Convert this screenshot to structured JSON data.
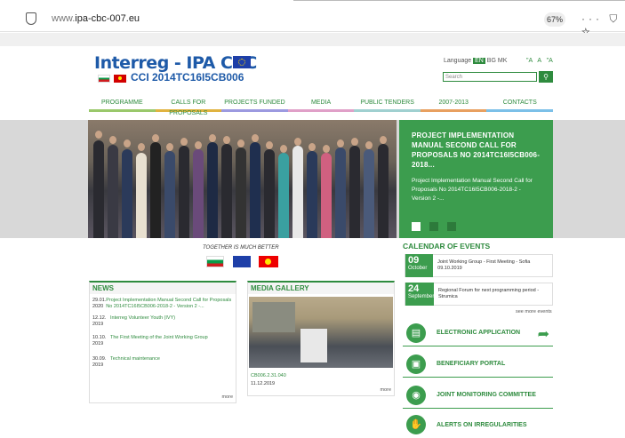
{
  "browser": {
    "url_prefix": "www.",
    "url_host": "ipa-cbc-007.eu",
    "zoom": "67%",
    "menu_icon": "···",
    "pocket_icon": "⛉",
    "star_icon": "☆"
  },
  "header": {
    "logo": "Interreg - IPA CBC",
    "cci": "CCI 2014TC16I5CB006",
    "language_label": "Language",
    "languages": [
      "EN",
      "BG",
      "MK"
    ],
    "font_sizes": [
      "\"A",
      "A",
      "\"A"
    ],
    "search_placeholder": "Search"
  },
  "nav": [
    "PROGRAMME",
    "CALLS FOR PROPOSALS",
    "PROJECTS FUNDED",
    "MEDIA",
    "PUBLIC TENDERS",
    "2007-2013",
    "CONTACTS"
  ],
  "slider": {
    "title": "PROJECT IMPLEMENTATION MANUAL SECOND CALL FOR PROPOSALS NO 2014TC16I5CB006-2018...",
    "text": "Project Implementation Manual Second Call for Proposals No 2014TC16I5CB006-2018-2 - Version 2 -..."
  },
  "tagline": "TOGETHER IS MUCH BETTER",
  "news": {
    "title": "NEWS",
    "items": [
      {
        "date": "29.01. 2020",
        "text": "Project Implementation Manual Second Call for Proposals No 2014TC16I5CB006-2018-2 - Version 2 -..."
      },
      {
        "date": "12.12. 2019",
        "text": "Interreg Volunteer Youth (IVY)"
      },
      {
        "date": "10.10. 2019",
        "text": "The First Meeting of the Joint Working Group"
      },
      {
        "date": "30.09. 2019",
        "text": "Technical maintenance"
      }
    ],
    "more": "more"
  },
  "media": {
    "title": "MEDIA GALLERY",
    "caption": "CB006.2.31.040",
    "date": "11.12.2019",
    "more": "more"
  },
  "calendar": {
    "title": "CALENDAR OF EVENTS",
    "events": [
      {
        "day": "09",
        "month": "October",
        "text": "Joint Working Group - First Meeting - Sofia 09.10.2019"
      },
      {
        "day": "24",
        "month": "September",
        "text": "Regional Forum for next programming period - Strumica"
      }
    ],
    "see_more": "see more events"
  },
  "links": [
    {
      "label": "ELECTRONIC APPLICATION",
      "icon": "document-icon"
    },
    {
      "label": "BENEFICIARY PORTAL",
      "icon": "briefcase-icon"
    },
    {
      "label": "JOINT MONITORING COMMITTEE",
      "icon": "compass-icon"
    },
    {
      "label": "ALERTS ON IRREGULARITIES",
      "icon": "handshake-icon"
    }
  ]
}
